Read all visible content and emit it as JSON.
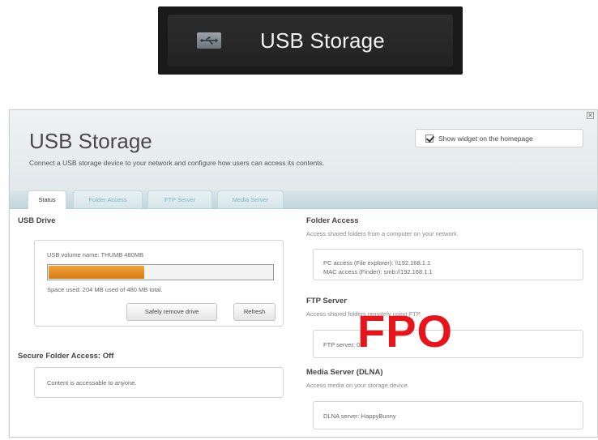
{
  "widget": {
    "icon": "usb-icon",
    "title": "USB Storage"
  },
  "panel": {
    "title": "USB Storage",
    "description": "Connect a USB storage device to your network and configure how users can access its contents.",
    "show_widget_label": "Show widget on the homepage",
    "show_widget_checked": true,
    "close_label": "✕"
  },
  "tabs": [
    {
      "label": "Status",
      "active": true
    },
    {
      "label": "Folder Access",
      "active": false
    },
    {
      "label": "FTP Server",
      "active": false
    },
    {
      "label": "Media Server",
      "active": false
    }
  ],
  "usb_drive": {
    "heading": "USB Drive",
    "volume_name": "USB volume name: THUMB 480MB",
    "used_fraction": 0.425,
    "space_used": "Space used: 204 MB used of 480 MB total.",
    "remove_button": "Safely remove drive",
    "refresh_button": "Refresh"
  },
  "secure_folder": {
    "heading": "Secure Folder Access: Off",
    "text": "Content is accessable to anyone."
  },
  "folder_access": {
    "heading": "Folder Access",
    "sub": "Access shared folders from a computer on your network.",
    "pc_access": "PC access (File explorer): \\\\192.168.1.1",
    "mac_access": "MAC access (Finder): smb://192.168.1.1"
  },
  "ftp_server": {
    "heading": "FTP Server",
    "sub": "Access shared folders remotely using FTP.",
    "text": "FTP server: 0"
  },
  "media_server": {
    "heading": "Media Server (DLNA)",
    "sub": "Access media on your storage device.",
    "text": "DLNA server: HappyBunny"
  },
  "overlay": {
    "fpo": "FPO",
    "color": "#e8141b"
  },
  "colors": {
    "progress": "#e38a1f",
    "tab_inactive_text": "#7fb5c5"
  }
}
